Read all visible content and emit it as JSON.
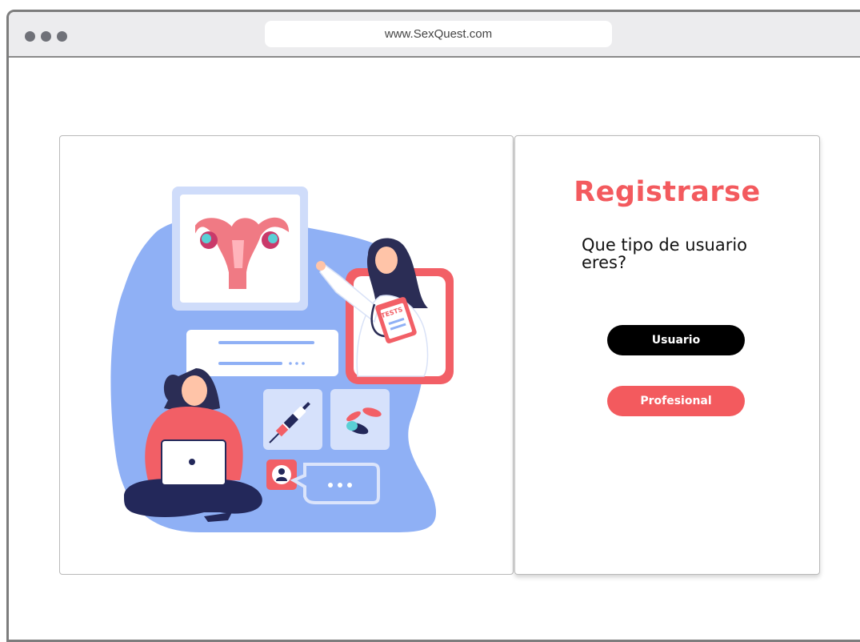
{
  "browser": {
    "url": "www.SexQuest.com"
  },
  "register": {
    "title": "Registrarse",
    "question": "Que tipo de usuario eres?",
    "user_button": "Usuario",
    "professional_button": "Profesional"
  },
  "illustration": {
    "clipboard_label": "TESTS"
  },
  "colors": {
    "accent": "#f35a5e",
    "blob": "#8fb0f5",
    "frame": "#cfdcfa",
    "dark_button": "#000000"
  }
}
